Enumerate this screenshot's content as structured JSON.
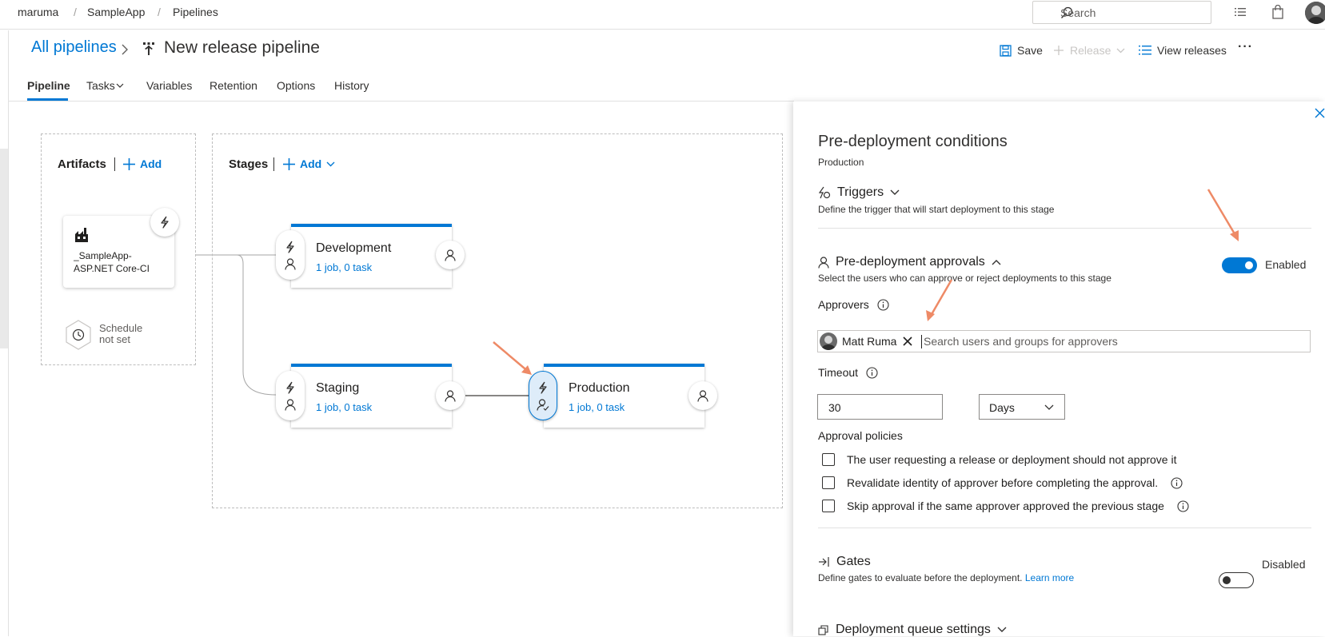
{
  "breadcrumb": {
    "org": "maruma",
    "project": "SampleApp",
    "section": "Pipelines",
    "sep": "/"
  },
  "search": {
    "placeholder": "Search"
  },
  "header": {
    "all_pipelines": "All pipelines",
    "title": "New release pipeline",
    "save": "Save",
    "release": "Release",
    "view_releases": "View releases",
    "more": "···"
  },
  "tabs": [
    "Pipeline",
    "Tasks",
    "Variables",
    "Retention",
    "Options",
    "History"
  ],
  "artifacts": {
    "title": "Artifacts",
    "add": "Add",
    "item_line1": "_SampleApp-",
    "item_line2": "ASP.NET Core-CI",
    "schedule_line1": "Schedule",
    "schedule_line2": "not set"
  },
  "stages": {
    "title": "Stages",
    "add": "Add",
    "items": [
      {
        "name": "Development",
        "jobs": "1 job, 0 task"
      },
      {
        "name": "Staging",
        "jobs": "1 job, 0 task"
      },
      {
        "name": "Production",
        "jobs": "1 job, 0 task"
      }
    ]
  },
  "panel": {
    "title": "Pre-deployment conditions",
    "stage": "Production",
    "triggers": {
      "title": "Triggers",
      "desc": "Define the trigger that will start deployment to this stage"
    },
    "approvals": {
      "title": "Pre-deployment approvals",
      "desc": "Select the users who can approve or reject deployments to this stage",
      "toggle": "Enabled",
      "enabled": true,
      "approvers_label": "Approvers",
      "approver": "Matt Ruma",
      "approver_placeholder": "Search users and groups for approvers",
      "timeout_label": "Timeout",
      "timeout_value": "30",
      "timeout_unit": "Days",
      "policies_label": "Approval policies",
      "policies": [
        "The user requesting a release or deployment should not approve it",
        "Revalidate identity of approver before completing the approval.",
        "Skip approval if the same approver approved the previous stage"
      ]
    },
    "gates": {
      "title": "Gates",
      "desc": "Define gates to evaluate before the deployment.",
      "learn_more": "Learn more",
      "toggle": "Disabled",
      "enabled": false
    },
    "queue": {
      "title": "Deployment queue settings"
    }
  },
  "colors": {
    "accent": "#0078d4",
    "annotation_arrow": "#ee8a66"
  }
}
